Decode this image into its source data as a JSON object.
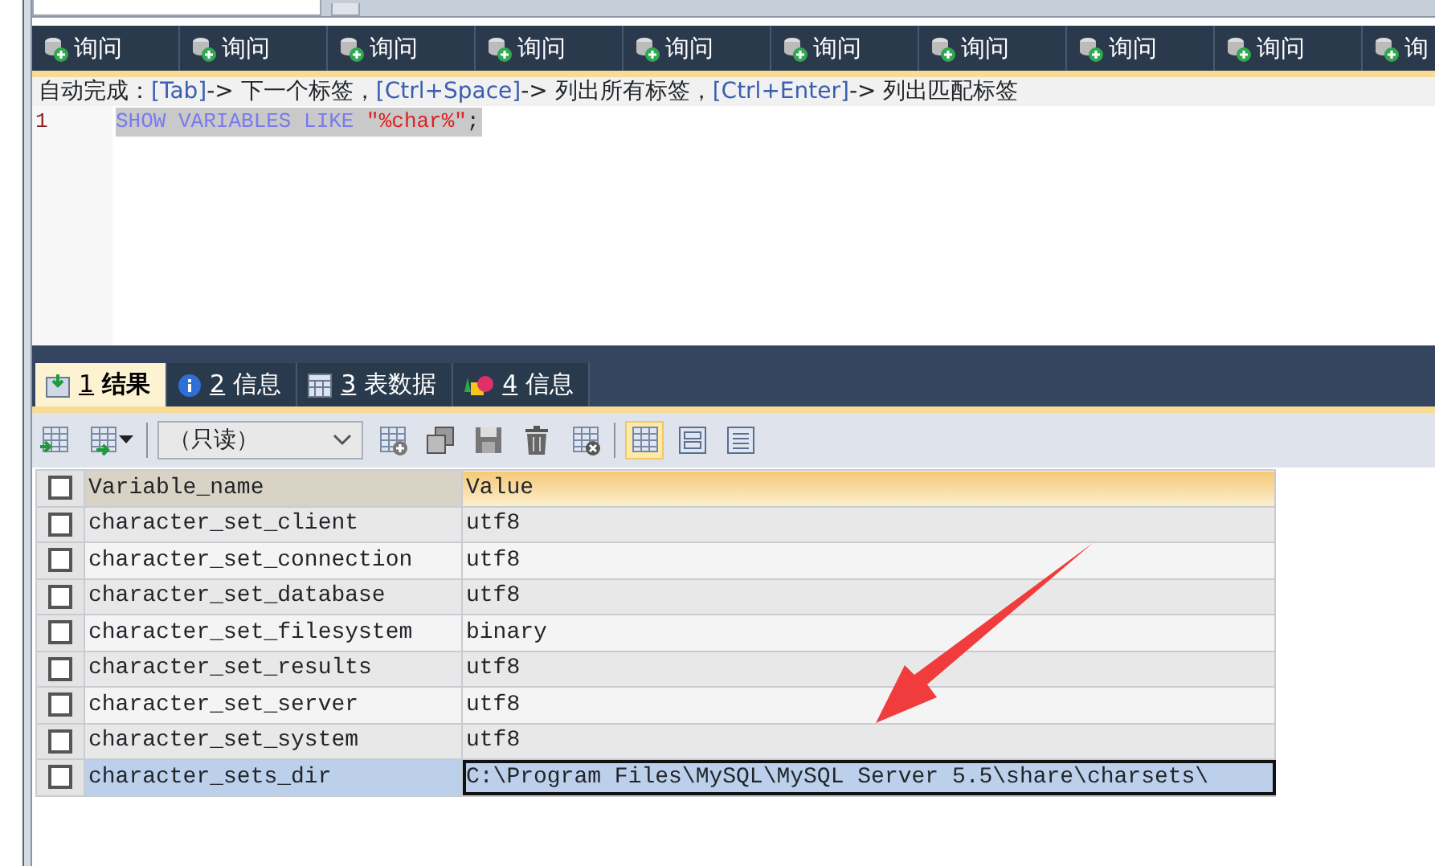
{
  "query_tabs": [
    {
      "label": "询问"
    },
    {
      "label": "询问"
    },
    {
      "label": "询问"
    },
    {
      "label": "询问"
    },
    {
      "label": "询问"
    },
    {
      "label": "询问"
    },
    {
      "label": "询问"
    },
    {
      "label": "询问"
    },
    {
      "label": "询问"
    },
    {
      "label": "询"
    }
  ],
  "hint": [
    {
      "kind": "text",
      "text": "自动完成："
    },
    {
      "kind": "key",
      "text": "[Tab]"
    },
    {
      "kind": "text",
      "text": "-> 下一个标签，"
    },
    {
      "kind": "key",
      "text": "[Ctrl+Space]"
    },
    {
      "kind": "text",
      "text": "-> 列出所有标签，"
    },
    {
      "kind": "key",
      "text": "[Ctrl+Enter]"
    },
    {
      "kind": "text",
      "text": "-> 列出匹配标签"
    }
  ],
  "editor": {
    "lines": [
      {
        "number": "1",
        "selected": true,
        "tokens": [
          {
            "kind": "keyword",
            "text": "SHOW VARIABLES LIKE"
          },
          {
            "kind": "string",
            "text": "\"%char%\""
          },
          {
            "kind": "punct",
            "text": ";"
          }
        ]
      }
    ]
  },
  "result_tabs": [
    {
      "kind": "result",
      "number": "1",
      "label": "结果",
      "selected": true
    },
    {
      "kind": "info",
      "number": "2",
      "label": "信息",
      "selected": false
    },
    {
      "kind": "table",
      "number": "3",
      "label": "表数据",
      "selected": false
    },
    {
      "kind": "profile",
      "number": "4",
      "label": "信息",
      "selected": false
    }
  ],
  "toolbar": {
    "mode_select": {
      "value": "（只读）"
    },
    "view_modes": [
      {
        "kind": "grid",
        "selected": true
      },
      {
        "kind": "form",
        "selected": false
      },
      {
        "kind": "text",
        "selected": false
      }
    ]
  },
  "table": {
    "select_all": {
      "checked": false
    },
    "columns": [
      "Variable_name",
      "Value"
    ],
    "rows": [
      {
        "checked": false,
        "selected": false,
        "cells": [
          "character_set_client",
          "utf8"
        ]
      },
      {
        "checked": false,
        "selected": false,
        "cells": [
          "character_set_connection",
          "utf8"
        ]
      },
      {
        "checked": false,
        "selected": false,
        "cells": [
          "character_set_database",
          "utf8"
        ]
      },
      {
        "checked": false,
        "selected": false,
        "cells": [
          "character_set_filesystem",
          "binary"
        ]
      },
      {
        "checked": false,
        "selected": false,
        "cells": [
          "character_set_results",
          "utf8"
        ]
      },
      {
        "checked": false,
        "selected": false,
        "cells": [
          "character_set_server",
          "utf8"
        ]
      },
      {
        "checked": false,
        "selected": false,
        "cells": [
          "character_set_system",
          "utf8"
        ]
      },
      {
        "checked": false,
        "selected": true,
        "cells": [
          "character_sets_dir",
          "C:\\Program Files\\MySQL\\MySQL Server 5.5\\share\\charsets\\"
        ]
      }
    ]
  }
}
